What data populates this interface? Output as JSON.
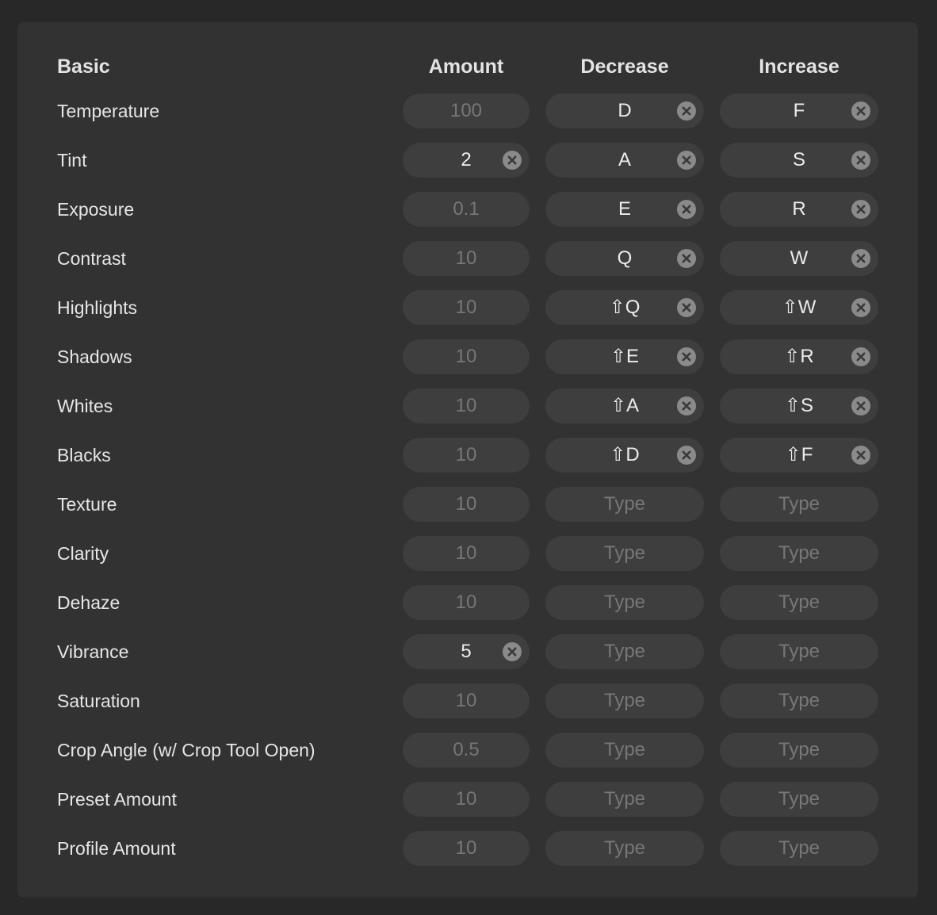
{
  "header": {
    "section": "Basic",
    "amount": "Amount",
    "decrease": "Decrease",
    "increase": "Increase"
  },
  "rows": [
    {
      "label": "Temperature",
      "amount": {
        "value": "100",
        "filled": false
      },
      "decrease": {
        "value": "D",
        "filled": true
      },
      "increase": {
        "value": "F",
        "filled": true
      }
    },
    {
      "label": "Tint",
      "amount": {
        "value": "2",
        "filled": true
      },
      "decrease": {
        "value": "A",
        "filled": true
      },
      "increase": {
        "value": "S",
        "filled": true
      }
    },
    {
      "label": "Exposure",
      "amount": {
        "value": "0.1",
        "filled": false
      },
      "decrease": {
        "value": "E",
        "filled": true
      },
      "increase": {
        "value": "R",
        "filled": true
      }
    },
    {
      "label": "Contrast",
      "amount": {
        "value": "10",
        "filled": false
      },
      "decrease": {
        "value": "Q",
        "filled": true
      },
      "increase": {
        "value": "W",
        "filled": true
      }
    },
    {
      "label": "Highlights",
      "amount": {
        "value": "10",
        "filled": false
      },
      "decrease": {
        "value": "⇧Q",
        "filled": true
      },
      "increase": {
        "value": "⇧W",
        "filled": true
      }
    },
    {
      "label": "Shadows",
      "amount": {
        "value": "10",
        "filled": false
      },
      "decrease": {
        "value": "⇧E",
        "filled": true
      },
      "increase": {
        "value": "⇧R",
        "filled": true
      }
    },
    {
      "label": "Whites",
      "amount": {
        "value": "10",
        "filled": false
      },
      "decrease": {
        "value": "⇧A",
        "filled": true
      },
      "increase": {
        "value": "⇧S",
        "filled": true
      }
    },
    {
      "label": "Blacks",
      "amount": {
        "value": "10",
        "filled": false
      },
      "decrease": {
        "value": "⇧D",
        "filled": true
      },
      "increase": {
        "value": "⇧F",
        "filled": true
      }
    },
    {
      "label": "Texture",
      "amount": {
        "value": "10",
        "filled": false
      },
      "decrease": {
        "value": "Type",
        "filled": false
      },
      "increase": {
        "value": "Type",
        "filled": false
      }
    },
    {
      "label": "Clarity",
      "amount": {
        "value": "10",
        "filled": false
      },
      "decrease": {
        "value": "Type",
        "filled": false
      },
      "increase": {
        "value": "Type",
        "filled": false
      }
    },
    {
      "label": "Dehaze",
      "amount": {
        "value": "10",
        "filled": false
      },
      "decrease": {
        "value": "Type",
        "filled": false
      },
      "increase": {
        "value": "Type",
        "filled": false
      }
    },
    {
      "label": "Vibrance",
      "amount": {
        "value": "5",
        "filled": true
      },
      "decrease": {
        "value": "Type",
        "filled": false
      },
      "increase": {
        "value": "Type",
        "filled": false
      }
    },
    {
      "label": "Saturation",
      "amount": {
        "value": "10",
        "filled": false
      },
      "decrease": {
        "value": "Type",
        "filled": false
      },
      "increase": {
        "value": "Type",
        "filled": false
      }
    },
    {
      "label": "Crop Angle (w/ Crop Tool Open)",
      "amount": {
        "value": "0.5",
        "filled": false
      },
      "decrease": {
        "value": "Type",
        "filled": false
      },
      "increase": {
        "value": "Type",
        "filled": false
      }
    },
    {
      "label": "Preset Amount",
      "amount": {
        "value": "10",
        "filled": false
      },
      "decrease": {
        "value": "Type",
        "filled": false
      },
      "increase": {
        "value": "Type",
        "filled": false
      }
    },
    {
      "label": "Profile Amount",
      "amount": {
        "value": "10",
        "filled": false
      },
      "decrease": {
        "value": "Type",
        "filled": false
      },
      "increase": {
        "value": "Type",
        "filled": false
      }
    }
  ],
  "icons": {
    "clear": "clear-x-circle-icon"
  },
  "colors": {
    "background": "#282828",
    "panel": "#323232",
    "field": "#3e3e3e",
    "placeholder_text": "#777777",
    "filled_text": "#ececec"
  }
}
